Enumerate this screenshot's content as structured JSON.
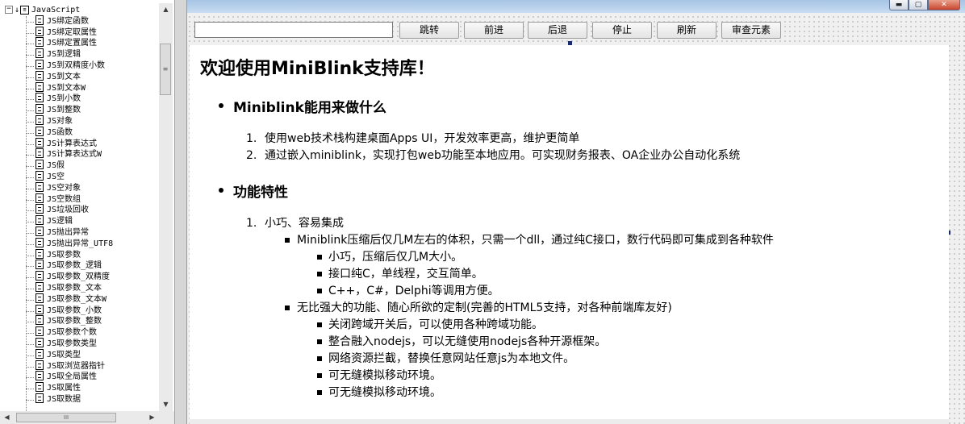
{
  "tree": {
    "root_label": "JavaScript",
    "root_expander": "−",
    "items": [
      "JS绑定函数",
      "JS绑定取属性",
      "JS绑定置属性",
      "JS到逻辑",
      "JS到双精度小数",
      "JS到文本",
      "JS到文本W",
      "JS到小数",
      "JS到整数",
      "JS对象",
      "JS函数",
      "JS计算表达式",
      "JS计算表达式W",
      "JS假",
      "JS空",
      "JS空对象",
      "JS空数组",
      "JS垃圾回收",
      "JS逻辑",
      "JS抛出异常",
      "JS抛出异常_UTF8",
      "JS取参数",
      "JS取参数_逻辑",
      "JS取参数_双精度",
      "JS取参数_文本",
      "JS取参数_文本W",
      "JS取参数_小数",
      "JS取参数_整数",
      "JS取参数个数",
      "JS取参数类型",
      "JS取类型",
      "JS取浏览器指针",
      "JS取全局属性",
      "JS取属性",
      "JS取数据"
    ],
    "vscroll": {
      "up_arrow": "▲",
      "down_arrow": "▼",
      "thumb_grip": "≡"
    },
    "hscroll": {
      "left_arrow": "◀",
      "right_arrow": "▶",
      "thumb_grip": "III"
    }
  },
  "window": {
    "minimize_glyph": "▬",
    "maximize_glyph": "▢",
    "close_glyph": "✕"
  },
  "toolbar": {
    "url_value": "",
    "buttons": {
      "go": "跳转",
      "forward": "前进",
      "back": "后退",
      "stop": "停止",
      "refresh": "刷新",
      "inspect": "审查元素"
    }
  },
  "page": {
    "title": "欢迎使用MiniBlink支持库！",
    "section1": {
      "title": "Miniblink能用来做什么",
      "items": [
        {
          "num": "1.",
          "text": "使用web技术栈构建桌面Apps UI，开发效率更高，维护更简单"
        },
        {
          "num": "2.",
          "text": "通过嵌入miniblink，实现打包web功能至本地应用。可实现财务报表、OA企业办公自动化系统"
        }
      ]
    },
    "section2": {
      "title": "功能特性",
      "item1": {
        "num": "1.",
        "text": "小巧、容易集成",
        "sub1": {
          "text": "Miniblink压缩后仅几M左右的体积，只需一个dll，通过纯C接口，数行代码即可集成到各种软件",
          "items": [
            "小巧，压缩后仅几M大小。",
            "接口纯C，单线程，交互简单。",
            "C++，C#，Delphi等调用方便。"
          ]
        },
        "sub2": {
          "text": "无比强大的功能、随心所欲的定制(完善的HTML5支持，对各种前端库友好)",
          "items": [
            "关闭跨域开关后，可以使用各种跨域功能。",
            "整合融入nodejs，可以无缝使用nodejs各种开源框架。",
            "网络资源拦截，替换任意网站任意js为本地文件。",
            "可无缝模拟移动环境。",
            "可无缝模拟移动环境。"
          ]
        }
      }
    }
  }
}
